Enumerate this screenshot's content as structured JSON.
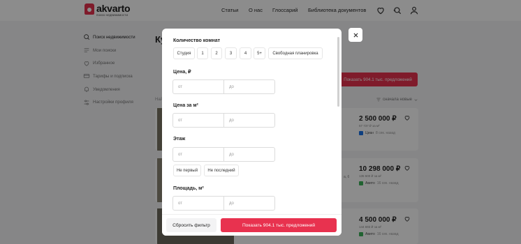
{
  "header": {
    "logo_name": "akvarto",
    "logo_sub": "поиск недвижимости",
    "nav": [
      "Статьи",
      "О нас",
      "Глоссарий",
      "Библиотека документов"
    ]
  },
  "sidebar": {
    "items": [
      {
        "label": "Поиск недвижимости",
        "icon": "search-icon",
        "active": true
      },
      {
        "label": "Мои поиски",
        "icon": "list-icon",
        "active": false
      },
      {
        "label": "Избранное",
        "icon": "heart-icon",
        "active": false
      },
      {
        "label": "Тарифы и подписка",
        "icon": "card-icon",
        "active": false
      },
      {
        "label": "Уведомления",
        "icon": "bell-icon",
        "active": false
      },
      {
        "label": "Настройки профиля",
        "icon": "sliders-icon",
        "active": false
      }
    ]
  },
  "main": {
    "title": "Ку",
    "found": "Най",
    "show_button": "Показать 904.1 тыс. предложений",
    "sort_label": "сначала новые",
    "cards": [
      {
        "price": "2 500 000 ₽",
        "ppm": "57 737 ₽ за м²",
        "source": "Циан",
        "time": "8 сек. назад",
        "address": "",
        "source_color": "#1a73e8"
      },
      {
        "price": "10 298 000 ₽",
        "ppm": "135 500 ₽ за м²",
        "source": "Авито",
        "time": "16 сек. назад",
        "address": "а, 6",
        "source_color": "#3db35a"
      },
      {
        "price": "4 500 000 ₽",
        "ppm": "144 693 ₽ за м²",
        "source": "Авито",
        "time": "16 сек. назад",
        "address": "",
        "source_color": "#3db35a"
      }
    ]
  },
  "modal": {
    "rooms": {
      "title": "Количество комнат",
      "options": [
        "Студия",
        "1",
        "2",
        "3",
        "4",
        "5+",
        "Свободная планировка"
      ]
    },
    "price": {
      "title": "Цена, ₽",
      "from": "от",
      "to": "до"
    },
    "price_m2": {
      "title": "Цена за м²",
      "from": "от",
      "to": "до"
    },
    "floor": {
      "title": "Этаж",
      "from": "от",
      "to": "до",
      "options": [
        "Не первый",
        "Не последний"
      ]
    },
    "area": {
      "title": "Площадь, м²",
      "from": "от",
      "to": "до"
    },
    "reset_button": "Сбросить фильтр",
    "show_button": "Показать 904.1 тыс. предложений"
  },
  "colors": {
    "accent": "#e8324f"
  }
}
